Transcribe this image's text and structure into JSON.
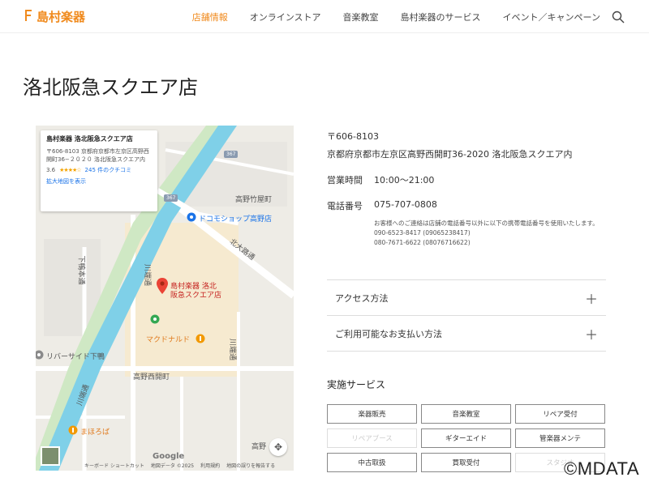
{
  "header": {
    "logo": "島村楽器",
    "nav": [
      "店舗情報",
      "オンラインストア",
      "音楽教室",
      "島村楽器のサービス",
      "イベント／キャンペーン"
    ],
    "active_index": 0
  },
  "page": {
    "title": "洛北阪急スクエア店"
  },
  "map": {
    "card": {
      "name": "島村楽器 洛北阪急スクエア店",
      "address": "〒606-8103 京都府京都市左京区高野西開町36−２０２０ 洛北阪急スクエア内",
      "rating": "3.6",
      "stars": "★★★★☆",
      "reviews": "245 件のクチコミ",
      "enlarge": "拡大地図を表示"
    },
    "labels": {
      "store": "島村楽器 洛北\n阪急スクエア店",
      "docomo": "ドコモショップ高野店",
      "mcd": "マクドナルド",
      "riverside": "リバーサイド下鴨",
      "mahoroba": "まほろば",
      "takano_takeya": "高野竹屋町",
      "takano_nishihiraki": "高野西開町",
      "takano": "高野",
      "kitaoji": "北大路通",
      "kawabata1": "川端通",
      "kawabata2": "川端通",
      "shimogamo": "下鴨本通",
      "route1": "367",
      "route2": "367",
      "google": "Google"
    },
    "footer": [
      "キーボード ショートカット",
      "地図データ ©2025",
      "利用規約",
      "地図の誤りを報告する"
    ]
  },
  "info": {
    "postal": "〒606-8103",
    "address": "京都府京都市左京区高野西開町36-2020 洛北阪急スクエア内",
    "hours_label": "営業時間",
    "hours": "10:00～21:00",
    "phone_label": "電話番号",
    "phone": "075-707-0808",
    "notice": "お客様へのご連絡は店舗の電話番号以外に以下の携帯電話番号を使用いたします。",
    "mobile1": "090-6523-8417 (09065238417)",
    "mobile2": "080-7671-6622 (08076716622)"
  },
  "accordion": [
    "アクセス方法",
    "ご利用可能なお支払い方法"
  ],
  "services": {
    "title": "実施サービス",
    "items": [
      {
        "label": "楽器販売",
        "enabled": true
      },
      {
        "label": "音楽教室",
        "enabled": true
      },
      {
        "label": "リペア受付",
        "enabled": true
      },
      {
        "label": "リペアブース",
        "enabled": false
      },
      {
        "label": "ギターエイド",
        "enabled": true
      },
      {
        "label": "管楽器メンテ",
        "enabled": true
      },
      {
        "label": "中古取扱",
        "enabled": true
      },
      {
        "label": "買取受付",
        "enabled": true
      },
      {
        "label": "スタジオ",
        "enabled": false
      }
    ]
  },
  "watermark": "©MDATA",
  "colors": {
    "brand": "#f08a1d",
    "link": "#1a73e8",
    "river": "#7fd0e8"
  }
}
